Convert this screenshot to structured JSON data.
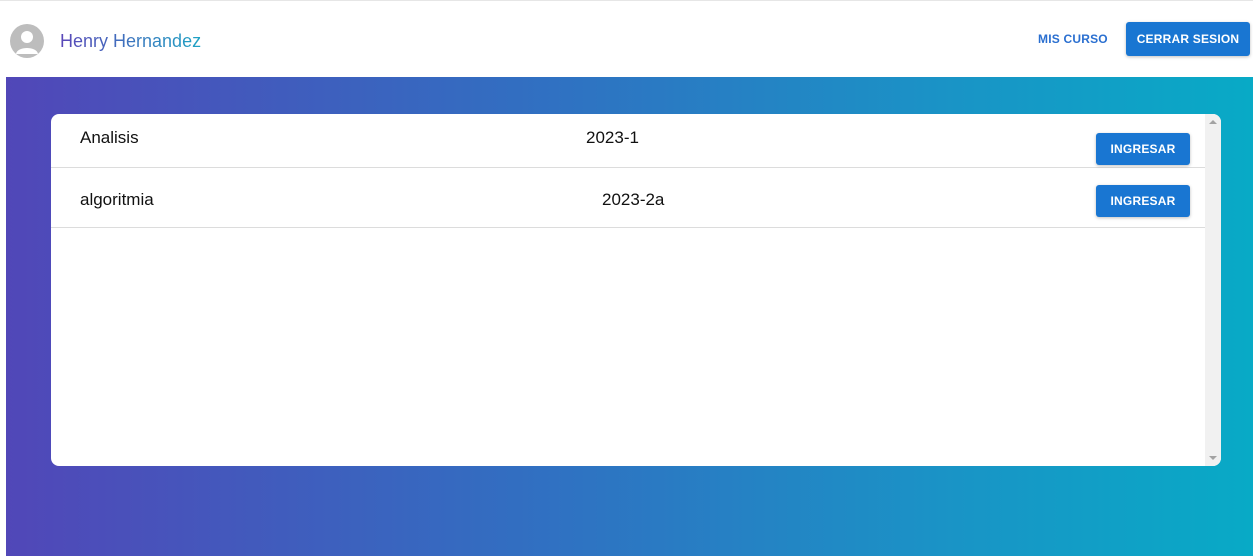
{
  "header": {
    "user_name": "Henry Hernandez",
    "nav_link_label": "MIS CURSO",
    "logout_label": "CERRAR SESION"
  },
  "courses": [
    {
      "name": "Analisis",
      "period": "2023-1",
      "action_label": "INGRESAR"
    },
    {
      "name": "algoritmia",
      "period": "2023-2a",
      "action_label": "INGRESAR"
    }
  ],
  "colors": {
    "primary": "#1976d2",
    "gradient_start": "#5147b8",
    "gradient_end": "#08aac6"
  },
  "icons": {
    "avatar": "person-icon",
    "scroll_up": "scroll-up-arrow-icon",
    "scroll_down": "scroll-down-arrow-icon"
  }
}
